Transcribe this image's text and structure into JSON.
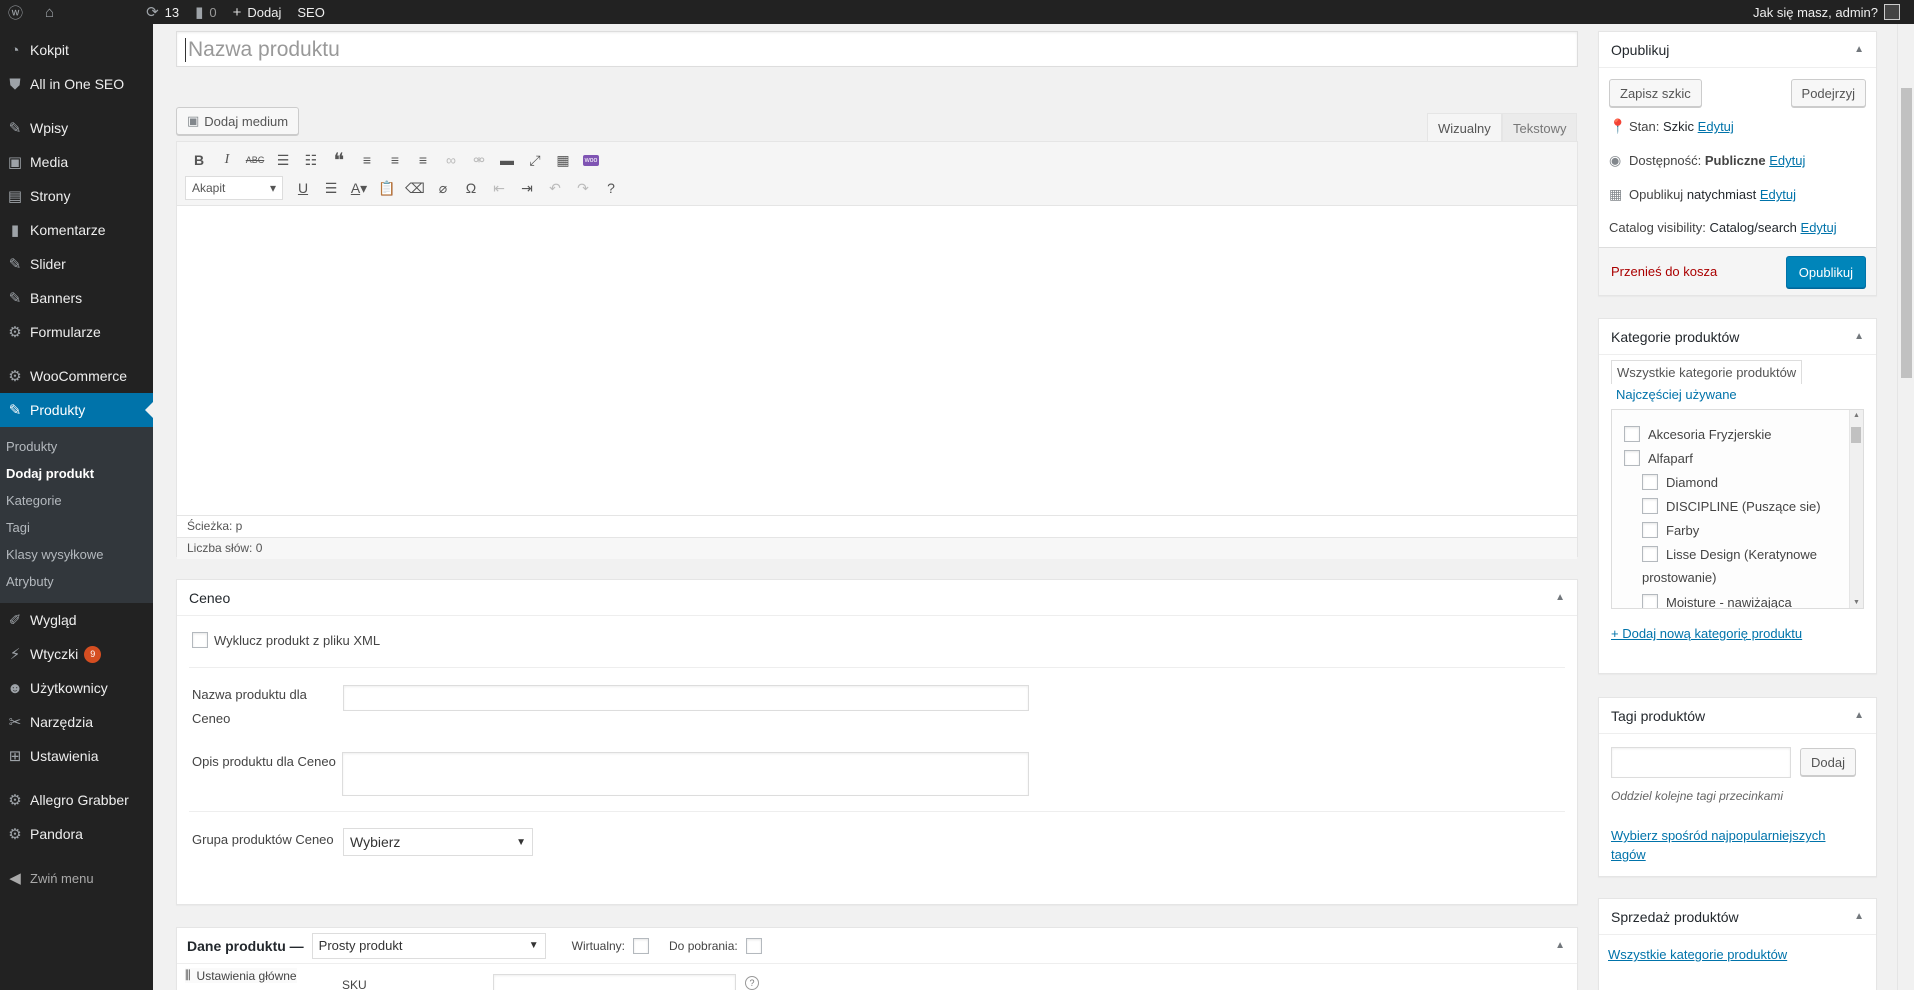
{
  "adminbar": {
    "updates_count": "13",
    "comments_count": "0",
    "add_label": "Dodaj",
    "seo_label": "SEO",
    "greeting": "Jak się masz, admin?"
  },
  "menu": {
    "items": [
      {
        "label": "Kokpit"
      },
      {
        "label": "All in One SEO"
      },
      {
        "label": "Wpisy"
      },
      {
        "label": "Media"
      },
      {
        "label": "Strony"
      },
      {
        "label": "Komentarze"
      },
      {
        "label": "Slider"
      },
      {
        "label": "Banners"
      },
      {
        "label": "Formularze"
      },
      {
        "label": "WooCommerce"
      },
      {
        "label": "Produkty"
      },
      {
        "label": "Wygląd"
      },
      {
        "label": "Wtyczki",
        "badge": "9"
      },
      {
        "label": "Użytkownicy"
      },
      {
        "label": "Narzędzia"
      },
      {
        "label": "Ustawienia"
      },
      {
        "label": "Allegro Grabber"
      },
      {
        "label": "Pandora"
      }
    ],
    "submenu": [
      "Produkty",
      "Dodaj produkt",
      "Kategorie",
      "Tagi",
      "Klasy wysyłkowe",
      "Atrybuty"
    ],
    "collapse_label": "Zwiń menu"
  },
  "editor": {
    "title_placeholder": "Nazwa produktu",
    "add_media": "Dodaj medium",
    "tab_visual": "Wizualny",
    "tab_text": "Tekstowy",
    "format_select": "Akapit",
    "path": "Ścieżka: p",
    "word_count": "Liczba słów: 0",
    "woo_icon_text": "woo"
  },
  "ceneo": {
    "title": "Ceneo",
    "exclude_label": "Wyklucz produkt z pliku XML",
    "name_label_1": "Nazwa produktu dla",
    "name_label_2": "Ceneo",
    "desc_label": "Opis produktu dla Ceneo",
    "group_label": "Grupa produktów Ceneo",
    "group_value": "Wybierz"
  },
  "product_data": {
    "title": "Dane produktu —",
    "type_value": "Prosty produkt",
    "virtual_label": "Wirtualny:",
    "download_label": "Do pobrania:",
    "general_tab": "Ustawienia główne",
    "sku_label": "SKU"
  },
  "publish": {
    "title": "Opublikuj",
    "save_draft": "Zapisz szkic",
    "preview": "Podejrzyj",
    "status_label": "Stan:",
    "status_value": "Szkic",
    "visibility_label": "Dostępność:",
    "visibility_value": "Publiczne",
    "schedule_label": "Opublikuj",
    "schedule_value": "natychmiast",
    "catalog_label": "Catalog visibility:",
    "catalog_value": "Catalog/search",
    "edit_link": "Edytuj",
    "trash": "Przenieś do kosza",
    "publish_button": "Opublikuj"
  },
  "categories": {
    "title": "Kategorie produktów",
    "tab_all": "Wszystkie kategorie produktów",
    "tab_popular": "Najczęściej używane",
    "items": [
      "Akcesoria Fryzjerskie",
      "Alfaparf",
      "Diamond",
      "DISCIPLINE (Puszące sie)",
      "Farby",
      "Lisse Design (Keratynowe",
      "prostowanie)",
      "Moisture - nawiżająca"
    ],
    "add_new": "+ Dodaj nową kategorię produktu"
  },
  "tags": {
    "title": "Tagi produktów",
    "add_button": "Dodaj",
    "hint": "Oddziel kolejne tagi przecinkami",
    "popular_link_1": "Wybierz spośród najpopularniejszych",
    "popular_link_2": "tagów"
  },
  "sales": {
    "title": "Sprzedaż produktów",
    "link": "Wszystkie kategorie produktów"
  },
  "colors": {
    "menu_bg": "#222222",
    "active": "#0073aa",
    "publish_button": "#0085ba",
    "trash": "#aa0000"
  }
}
